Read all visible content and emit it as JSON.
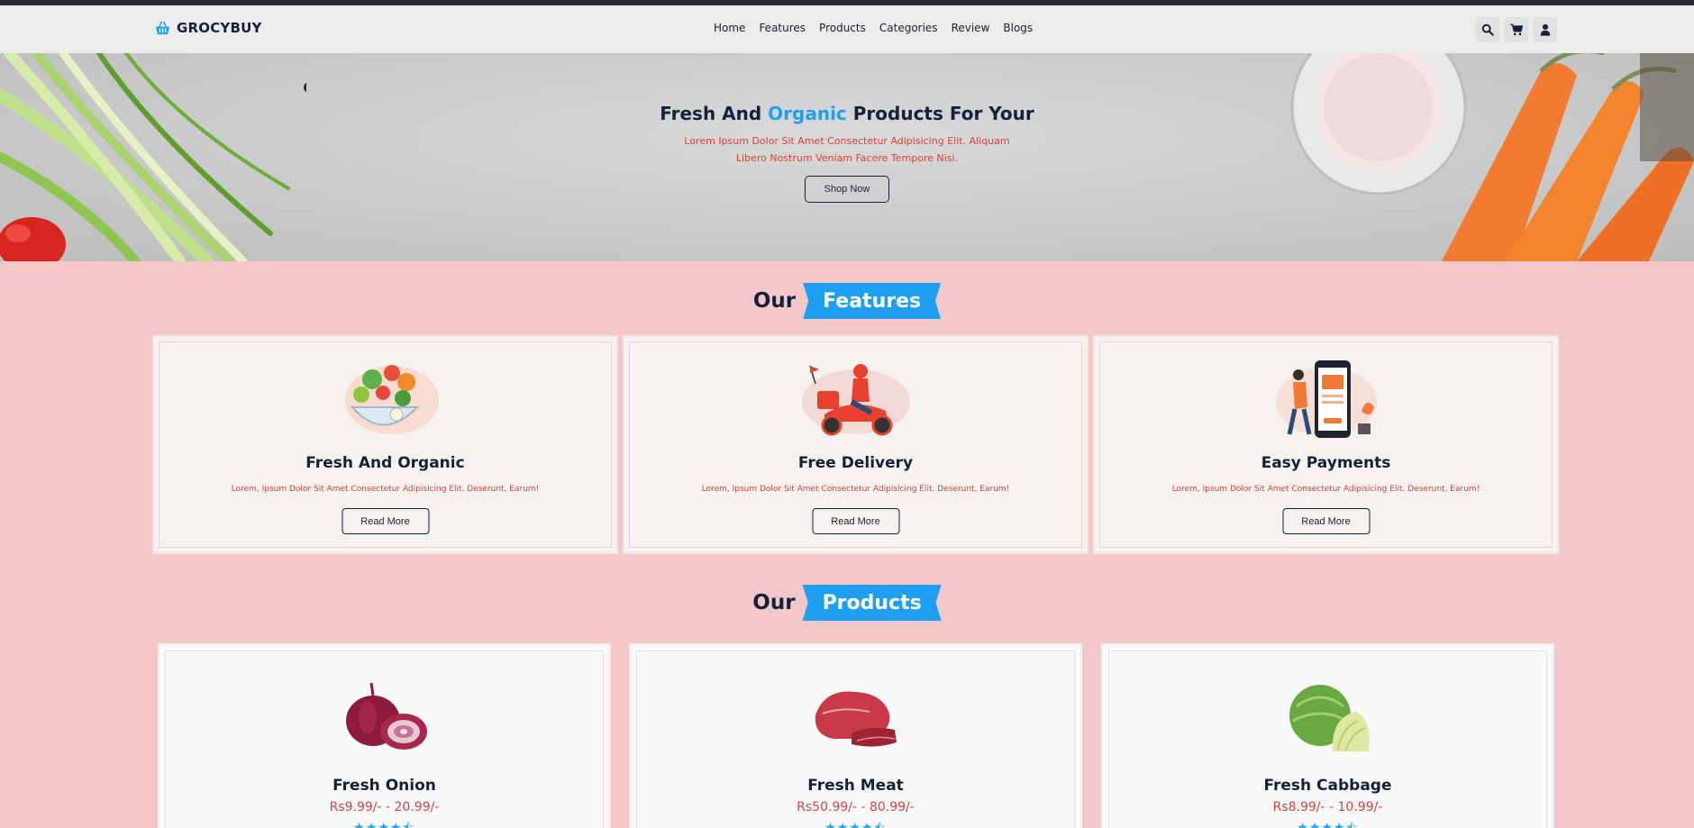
{
  "brand": {
    "name": "GROCYBUY",
    "accent": "#1e9ff2",
    "navy": "#14213d",
    "red": "#d9423c"
  },
  "nav": {
    "links": [
      {
        "label": "Home"
      },
      {
        "label": "Features"
      },
      {
        "label": "Products"
      },
      {
        "label": "Categories"
      },
      {
        "label": "Review"
      },
      {
        "label": "Blogs"
      }
    ],
    "icons": [
      "search-icon",
      "cart-icon",
      "user-icon"
    ]
  },
  "hero": {
    "title_before": "Fresh And ",
    "title_highlight": "Organic",
    "title_after": " Products For Your",
    "text": "Lorem Ipsum Dolor Sit Amet Consectetur Adipisicing Elit. Aliquam Libero Nostrum Veniam Facere Tempore Nisi.",
    "button": "Shop Now"
  },
  "features_section": {
    "title_plain": "Our",
    "title_ribbon": "Features",
    "cards": [
      {
        "title": "Fresh And Organic",
        "desc": "Lorem, Ipsum Dolor Sit Amet Consectetur Adipisicing Elit. Deserunt, Earum!",
        "button": "Read More",
        "illustration": "salad-bowl-illustration"
      },
      {
        "title": "Free Delivery",
        "desc": "Lorem, Ipsum Dolor Sit Amet Consectetur Adipisicing Elit. Deserunt, Earum!",
        "button": "Read More",
        "illustration": "scooter-delivery-illustration"
      },
      {
        "title": "Easy Payments",
        "desc": "Lorem, Ipsum Dolor Sit Amet Consectetur Adipisicing Elit. Deserunt, Earum!",
        "button": "Read More",
        "illustration": "phone-payment-illustration"
      }
    ]
  },
  "products_section": {
    "title_plain": "Our",
    "title_ribbon": "Products",
    "items": [
      {
        "name": "Fresh Onion",
        "price": "Rs9.99/- - 20.99/-",
        "rating": 4.5,
        "stars": "★★★★⯪",
        "image": "onion-image"
      },
      {
        "name": "Fresh Meat",
        "price": "Rs50.99/- - 80.99/-",
        "rating": 4.5,
        "stars": "★★★★⯪",
        "image": "meat-image"
      },
      {
        "name": "Fresh Cabbage",
        "price": "Rs8.99/- - 10.99/-",
        "rating": 4.5,
        "stars": "★★★★⯪",
        "image": "cabbage-image"
      }
    ]
  }
}
